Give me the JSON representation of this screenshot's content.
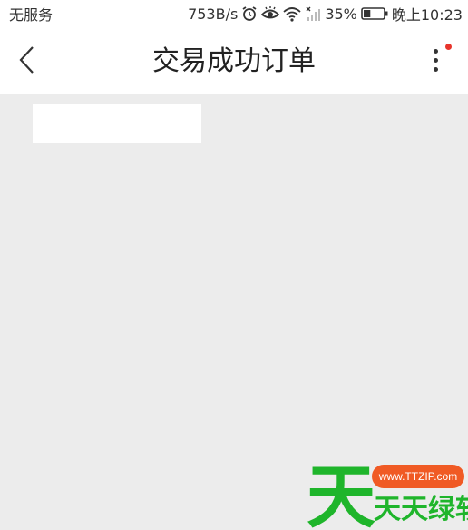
{
  "status_bar": {
    "carrier": "无服务",
    "net_speed": "753B/s",
    "battery_percent": "35%",
    "time": "晚上10:23",
    "icons": [
      "alarm-icon",
      "eye-icon",
      "wifi-icon",
      "signal-icon",
      "battery-icon"
    ],
    "battery_level": 0.35
  },
  "header": {
    "title": "交易成功订单",
    "back_icon": "chevron-left-icon",
    "more_icon": "more-vertical-icon",
    "notify_color": "#e8352c"
  },
  "content": {
    "background": "#ececec"
  },
  "watermark": {
    "big_char": "天",
    "url": "www.TTZIP.com",
    "name": "天天绿软",
    "brand_green": "#1fb52b",
    "pill_color": "#f05a24"
  }
}
